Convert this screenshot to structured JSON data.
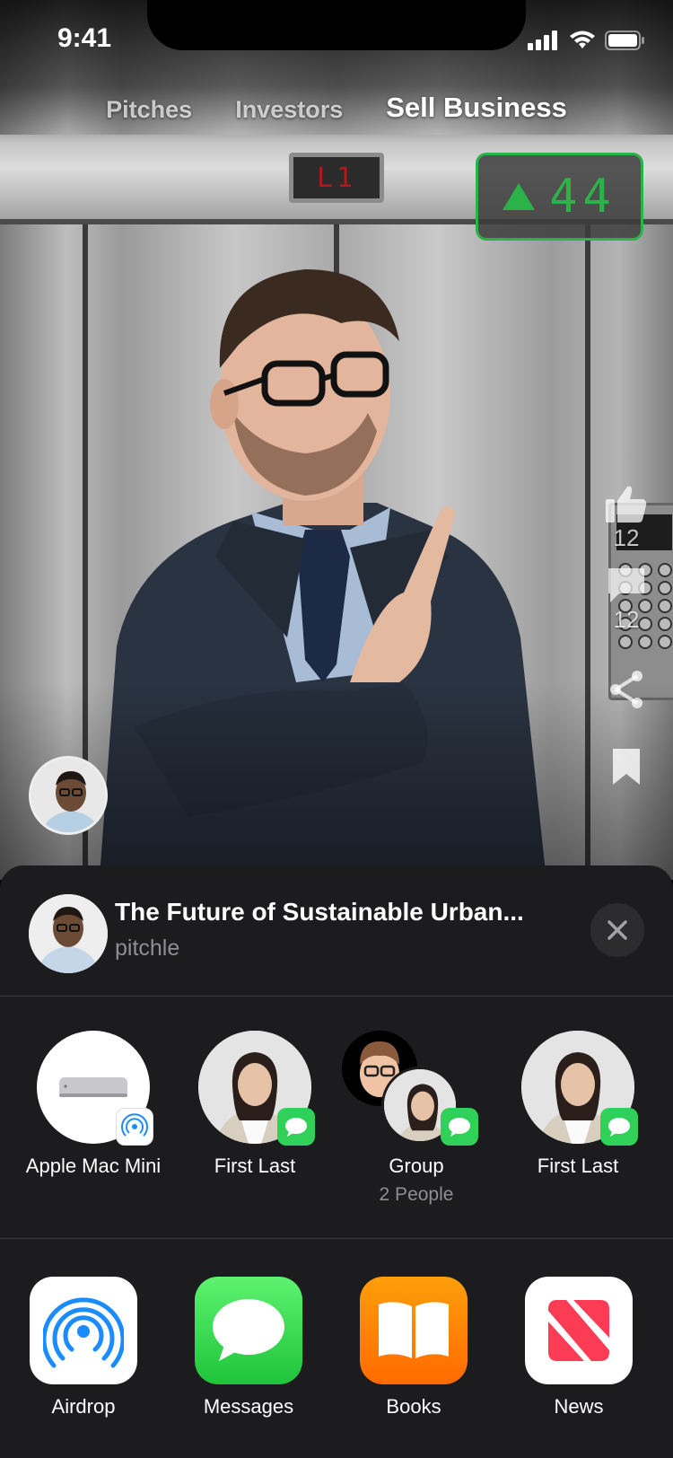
{
  "status_bar": {
    "time": "9:41"
  },
  "tabs": [
    {
      "label": "Pitches",
      "active": false
    },
    {
      "label": "Investors",
      "active": false
    },
    {
      "label": "Sell Business",
      "active": true
    }
  ],
  "video": {
    "floor_display": "L1",
    "counter": "44",
    "accent_color": "#2bb34a"
  },
  "rail": {
    "likes": "12",
    "comments": "12"
  },
  "share_sheet": {
    "title": "The Future of Sustainable Urban...",
    "subtitle": "pitchle",
    "contacts": [
      {
        "name": "Apple Mac Mini",
        "type": "airdrop-device"
      },
      {
        "name": "First Last",
        "type": "messages"
      },
      {
        "name": "Group",
        "sub": "2 People",
        "type": "messages-group"
      },
      {
        "name": "First Last",
        "type": "messages"
      }
    ],
    "apps": [
      {
        "label": "Airdrop",
        "icon": "airdrop-icon"
      },
      {
        "label": "Messages",
        "icon": "messages-icon"
      },
      {
        "label": "Books",
        "icon": "books-icon"
      },
      {
        "label": "News",
        "icon": "news-icon"
      }
    ]
  }
}
